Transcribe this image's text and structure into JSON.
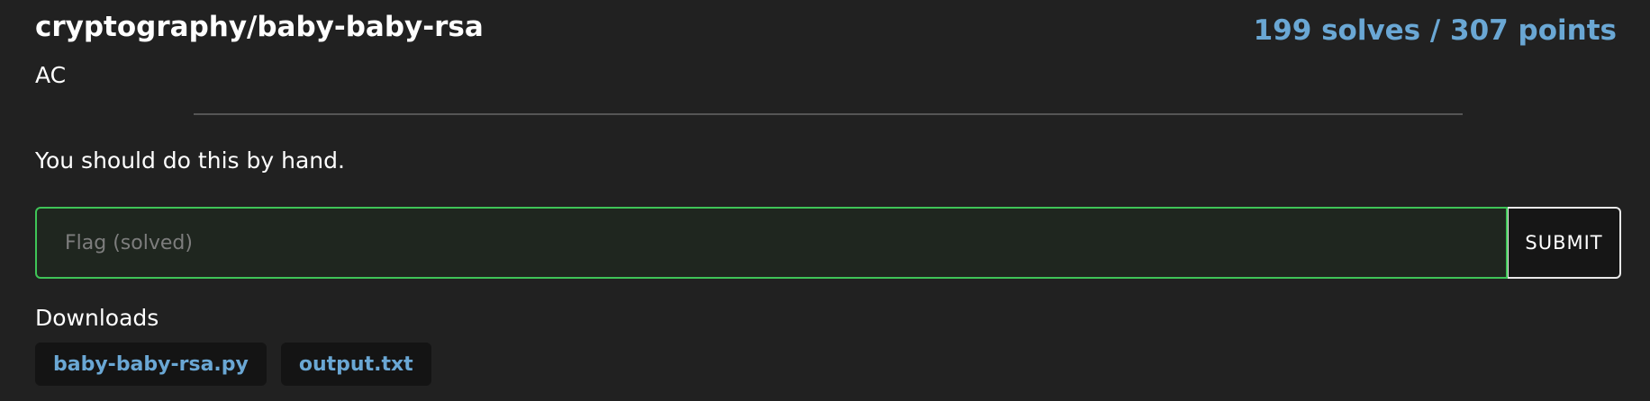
{
  "challenge": {
    "title": "cryptography/baby-baby-rsa",
    "stats": "199 solves / 307 points",
    "author": "AC",
    "description": "You should do this by hand."
  },
  "flag_form": {
    "placeholder": "Flag (solved)",
    "value": "",
    "submit_label": "SUBMIT"
  },
  "downloads": {
    "heading": "Downloads",
    "files": [
      {
        "label": "baby-baby-rsa.py"
      },
      {
        "label": "output.txt"
      }
    ]
  },
  "colors": {
    "background": "#212121",
    "accent": "#6aa7d4",
    "solved_border": "#3fc457"
  }
}
